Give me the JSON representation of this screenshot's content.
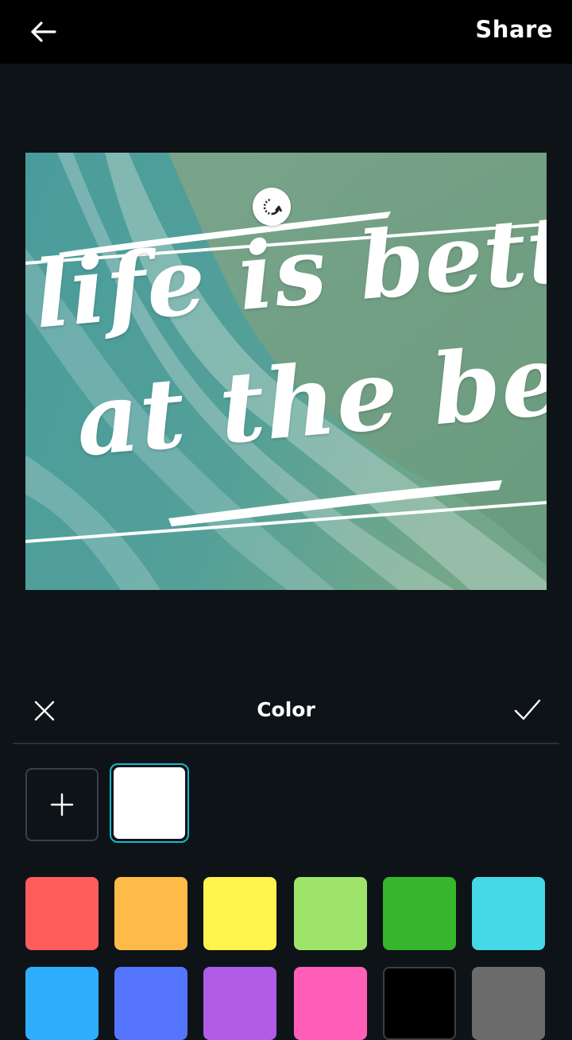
{
  "header": {
    "back_icon": "arrow-left-icon",
    "share_label": "Share"
  },
  "design": {
    "text_line1": "life is better",
    "text_line2": "at the beach",
    "rotate_icon": "rotate-icon"
  },
  "color_panel": {
    "title": "Color",
    "close_icon": "close-icon",
    "confirm_icon": "checkmark-icon",
    "add_icon": "plus-icon",
    "current_color": "#ffffff",
    "swatches": [
      "#ff5c5c",
      "#ffbb47",
      "#fff34d",
      "#9ee36a",
      "#35b62b",
      "#45d8e6",
      "#2fadff",
      "#5675ff",
      "#b05ce6",
      "#ff5fb8",
      "#000000",
      "#6b6b6b"
    ]
  }
}
